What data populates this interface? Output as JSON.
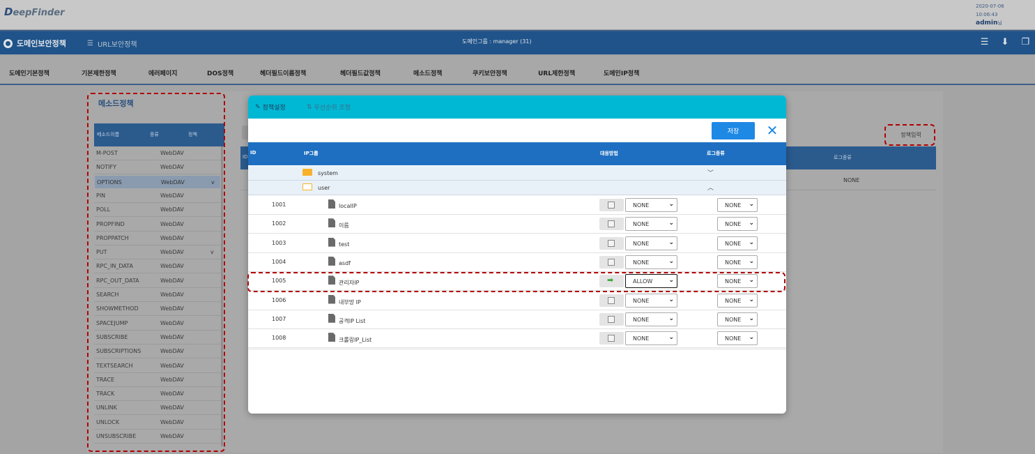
{
  "app": {
    "logo_first": "D",
    "logo_rest": "eepFinder",
    "date": "2020-07-06",
    "time": "10:06:43",
    "user": "admin",
    "user_suffix": "님"
  },
  "navbar": {
    "domain_policy": "도메인보안정책",
    "url_policy": "URL보안정책",
    "domain_group": "도메인그룹 : manager (31)"
  },
  "subnav": [
    "도메인기본정책",
    "기본제한정책",
    "에러페이지",
    "DOS정책",
    "헤더필드이름정책",
    "헤더필드값정책",
    "메소드정책",
    "쿠키보안정책",
    "URL제한정책",
    "도메인IP정책"
  ],
  "method_panel": {
    "title": "메소드정책",
    "headers": [
      "메소드이름",
      "종류",
      "정책"
    ],
    "rows": [
      {
        "name": "M-POST",
        "type": "WebDAV",
        "policy": ""
      },
      {
        "name": "NOTIFY",
        "type": "WebDAV",
        "policy": ""
      },
      {
        "name": "OPTIONS",
        "type": "WebDAV",
        "policy": "v"
      },
      {
        "name": "PIN",
        "type": "WebDAV",
        "policy": ""
      },
      {
        "name": "POLL",
        "type": "WebDAV",
        "policy": ""
      },
      {
        "name": "PROPFIND",
        "type": "WebDAV",
        "policy": ""
      },
      {
        "name": "PROPPATCH",
        "type": "WebDAV",
        "policy": ""
      },
      {
        "name": "PUT",
        "type": "WebDAV",
        "policy": "v"
      },
      {
        "name": "RPC_IN_DATA",
        "type": "WebDAV",
        "policy": ""
      },
      {
        "name": "RPC_OUT_DATA",
        "type": "WebDAV",
        "policy": ""
      },
      {
        "name": "SEARCH",
        "type": "WebDAV",
        "policy": ""
      },
      {
        "name": "SHOWMETHOD",
        "type": "WebDAV",
        "policy": ""
      },
      {
        "name": "SPACEJUMP",
        "type": "WebDAV",
        "policy": ""
      },
      {
        "name": "SUBSCRIBE",
        "type": "WebDAV",
        "policy": ""
      },
      {
        "name": "SUBSCRIPTIONS",
        "type": "WebDAV",
        "policy": ""
      },
      {
        "name": "TEXTSEARCH",
        "type": "WebDAV",
        "policy": ""
      },
      {
        "name": "TRACE",
        "type": "WebDAV",
        "policy": ""
      },
      {
        "name": "TRACK",
        "type": "WebDAV",
        "policy": ""
      },
      {
        "name": "UNLINK",
        "type": "WebDAV",
        "policy": ""
      },
      {
        "name": "UNLOCK",
        "type": "WebDAV",
        "policy": ""
      },
      {
        "name": "UNSUBSCRIBE",
        "type": "WebDAV",
        "policy": ""
      }
    ]
  },
  "bg_table": {
    "id_header": "ID",
    "log_header": "로그종류",
    "log_value": "NONE",
    "input_button": "정책입력"
  },
  "modal": {
    "tab_policy": "정책설정",
    "tab_priority": "우선순위 조정",
    "save": "저장",
    "headers": {
      "id": "ID",
      "ip_group": "IP그룹",
      "action": "대응방법",
      "log": "로그종류"
    },
    "folders": [
      {
        "name": "system",
        "chevron": "﹀"
      },
      {
        "name": "user",
        "chevron": "︿"
      }
    ],
    "rows": [
      {
        "id": "1001",
        "name": "localIP",
        "action": "NONE",
        "log": "NONE"
      },
      {
        "id": "1002",
        "name": "이름",
        "action": "NONE",
        "log": "NONE"
      },
      {
        "id": "1003",
        "name": "test",
        "action": "NONE",
        "log": "NONE"
      },
      {
        "id": "1004",
        "name": "asdf",
        "action": "NONE",
        "log": "NONE"
      },
      {
        "id": "1005",
        "name": "관리자IP",
        "action": "ALLOW",
        "log": "NONE"
      },
      {
        "id": "1006",
        "name": "내부망 IP",
        "action": "NONE",
        "log": "NONE"
      },
      {
        "id": "1007",
        "name": "공격IP List",
        "action": "NONE",
        "log": "NONE"
      },
      {
        "id": "1008",
        "name": "크롤링IP_List",
        "action": "NONE",
        "log": "NONE"
      }
    ]
  },
  "colors": {
    "navbar": "#1f5389",
    "modal_top": "#00b8d4",
    "header": "#1e6fc1",
    "accent": "#1e88e5",
    "highlight": "#b10000"
  }
}
